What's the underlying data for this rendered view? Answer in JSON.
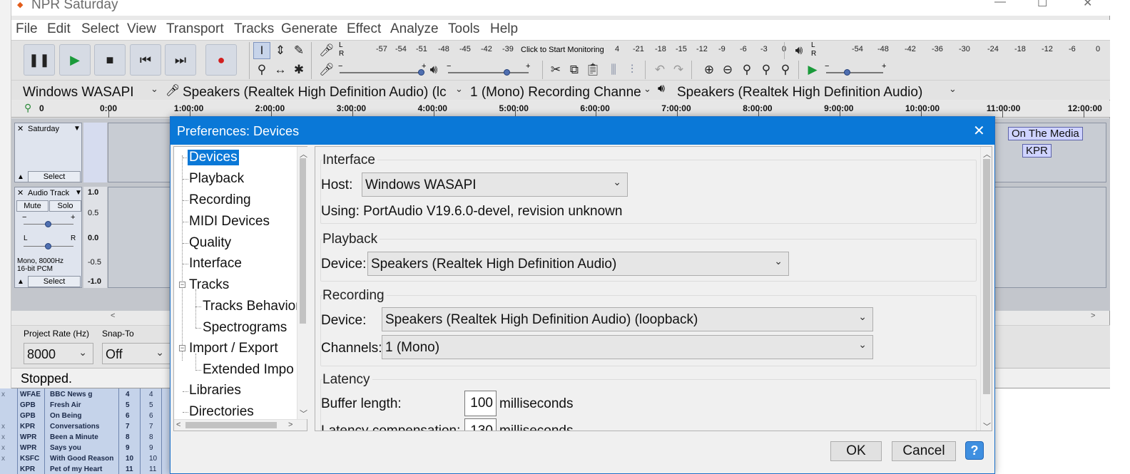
{
  "window": {
    "title": "NPR Saturday",
    "controls": {
      "minimize": "—",
      "maximize": "☐",
      "close": "✕"
    }
  },
  "menu": [
    "File",
    "Edit",
    "Select",
    "View",
    "Transport",
    "Tracks",
    "Generate",
    "Effect",
    "Analyze",
    "Tools",
    "Help"
  ],
  "meter": {
    "record_prompt": "Click to Start Monitoring",
    "record_scale": [
      "-57",
      "-54",
      "-51",
      "-48",
      "-45",
      "-42",
      "-39",
      "-3",
      "4",
      "-21",
      "-18",
      "-15",
      "-12",
      "-9",
      "-6",
      "-3",
      "0"
    ],
    "play_scale": [
      "-54",
      "-48",
      "-42",
      "-36",
      "-30",
      "-24",
      "-18",
      "-12",
      "-6",
      "0"
    ],
    "lr": [
      "L",
      "R"
    ]
  },
  "devices": {
    "host": "Windows WASAPI",
    "recording_device": "Speakers (Realtek High Definition Audio) (lc",
    "channels": "1 (Mono) Recording Channe",
    "playback_device": "Speakers (Realtek High Definition Audio)"
  },
  "timeline": {
    "start_label": "0",
    "ticks": [
      "0:00",
      "1:00:00",
      "2:00:00",
      "3:00:00",
      "4:00:00",
      "5:00:00",
      "6:00:00",
      "7:00:00",
      "8:00:00",
      "9:00:00",
      "10:00:00",
      "11:00:00",
      "12:00:00"
    ]
  },
  "tracks": {
    "label_track": {
      "name": "Saturday",
      "select": "Select"
    },
    "audio_track": {
      "name": "Audio Track",
      "mute": "Mute",
      "solo": "Solo",
      "pan_l": "L",
      "pan_r": "R",
      "gain_minus": "−",
      "gain_plus": "+",
      "info_line1": "Mono, 8000Hz",
      "info_line2": "16-bit PCM",
      "select": "Select",
      "scale": [
        "1.0",
        "0.5",
        "0.0",
        "-0.5",
        "-1.0"
      ]
    },
    "labels": [
      "On The Media",
      "KPR"
    ]
  },
  "bottom": {
    "project_rate_label": "Project Rate (Hz)",
    "project_rate": "8000",
    "snap_to_label": "Snap-To",
    "snap_to": "Off",
    "status": "Stopped."
  },
  "spreadsheet": {
    "rows": [
      {
        "x": "x",
        "station": "WFAE",
        "show": "BBC News g",
        "n": "4",
        "m": "4"
      },
      {
        "x": "",
        "station": "GPB",
        "show": "Fresh Air",
        "n": "5",
        "m": "5"
      },
      {
        "x": "",
        "station": "GPB",
        "show": "On Being",
        "n": "6",
        "m": "6"
      },
      {
        "x": "x",
        "station": "KPR",
        "show": "Conversations",
        "n": "7",
        "m": "7"
      },
      {
        "x": "x",
        "station": "WPR",
        "show": "Been a Minute",
        "n": "8",
        "m": "8"
      },
      {
        "x": "x",
        "station": "WPR",
        "show": "Says you",
        "n": "9",
        "m": "9"
      },
      {
        "x": "x",
        "station": "KSFC",
        "show": "With Good Reason",
        "n": "10",
        "m": "10"
      },
      {
        "x": "",
        "station": "KPR",
        "show": "Pet of my Heart",
        "n": "11",
        "m": "11"
      }
    ]
  },
  "dialog": {
    "title": "Preferences: Devices",
    "close": "✕",
    "tree": [
      "Devices",
      "Playback",
      "Recording",
      "MIDI Devices",
      "Quality",
      "Interface",
      "Tracks",
      "Tracks Behavior",
      "Spectrograms",
      "Import / Export",
      "Extended Impo",
      "Libraries",
      "Directories"
    ],
    "interface": {
      "heading": "Interface",
      "host_label": "Host:",
      "host_value": "Windows WASAPI",
      "using": "Using: PortAudio V19.6.0-devel, revision unknown"
    },
    "playback": {
      "heading": "Playback",
      "device_label": "Device:",
      "device_value": "Speakers (Realtek High Definition Audio)"
    },
    "recording": {
      "heading": "Recording",
      "device_label": "Device:",
      "device_value": "Speakers (Realtek High Definition Audio) (loopback)",
      "channels_label": "Channels:",
      "channels_value": "1 (Mono)"
    },
    "latency": {
      "heading": "Latency",
      "buffer_label": "Buffer length:",
      "buffer_value": "100",
      "buffer_unit": "milliseconds",
      "comp_label": "Latency compensation:",
      "comp_value": "-130",
      "comp_unit": "milliseconds"
    },
    "buttons": {
      "ok": "OK",
      "cancel": "Cancel",
      "help": "?"
    }
  }
}
